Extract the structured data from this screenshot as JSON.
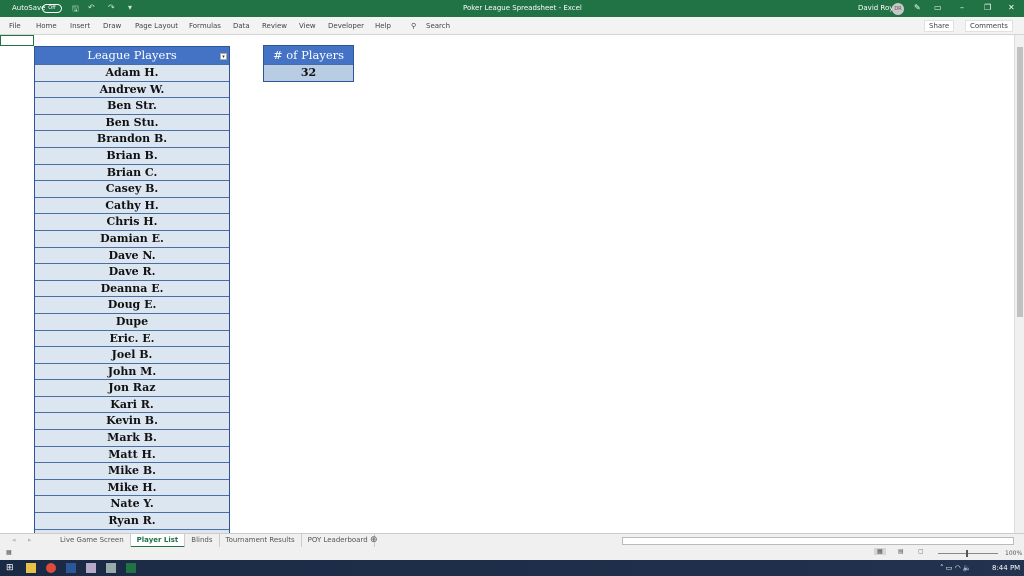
{
  "titlebar": {
    "autosave": "AutoSave",
    "toggle": "Off",
    "title": "Poker League Spreadsheet  -  Excel",
    "user": "David Roy",
    "initials": "DR"
  },
  "menu": {
    "items": [
      "File",
      "Home",
      "Insert",
      "Draw",
      "Page Layout",
      "Formulas",
      "Data",
      "Review",
      "View",
      "Developer",
      "Help"
    ],
    "search": "Search",
    "share": "Share",
    "comments": "Comments"
  },
  "table": {
    "header": "League Players",
    "players": [
      "Adam H.",
      "Andrew W.",
      "Ben Str.",
      "Ben Stu.",
      "Brandon B.",
      "Brian B.",
      "Brian C.",
      "Casey B.",
      "Cathy H.",
      "Chris H.",
      "Damian E.",
      "Dave N.",
      "Dave R.",
      "Deanna E.",
      "Doug E.",
      "Dupe",
      "Eric. E.",
      "Joel B.",
      "John M.",
      "Jon Raz",
      "Kari R.",
      "Kevin B.",
      "Mark B.",
      "Matt H.",
      "Mike B.",
      "Mike H.",
      "Nate Y.",
      "Ryan R."
    ]
  },
  "count": {
    "header": "# of Players",
    "value": "32"
  },
  "tabs": [
    "Live Game Screen",
    "Player List",
    "Blinds",
    "Tournament Results",
    "POY Leaderboard"
  ],
  "active_tab": "Player List",
  "status": {
    "zoom": "100%"
  },
  "taskbar": {
    "time": "8:44 PM"
  },
  "colors": {
    "excel_green": "#217346",
    "header_blue": "#4472c4",
    "row_fill": "#dce6f1",
    "count_fill": "#b8cce4"
  }
}
